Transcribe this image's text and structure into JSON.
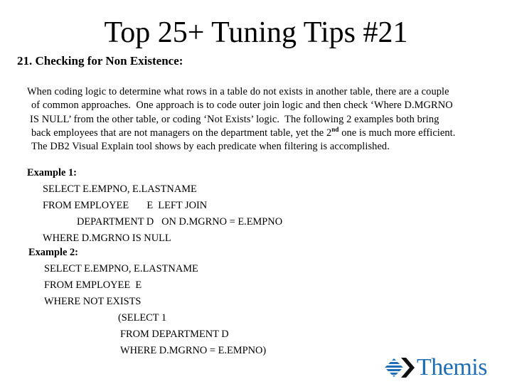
{
  "title": "Top 25+ Tuning Tips #21",
  "subheading": "21. Checking for Non Existence:",
  "paragraph": {
    "lines": [
      "When coding logic to determine what rows in a table do not exists in another table, there are a couple",
      "of common approaches.  One approach is to code outer join logic and then check ‘Where D.MGRNO",
      "IS NULL’ from the other table, or coding ‘Not Exists’ logic.  The following 2 examples both bring"
    ],
    "line4_before": "back employees that are not managers on the department table, yet the 2",
    "line4_sup": "nd",
    "line4_after": " one is much more efficient.",
    "line5": "The DB2 Visual Explain tool shows by each predicate when filtering is accomplished."
  },
  "example1": {
    "heading": "Example 1:",
    "lines": [
      "SELECT E.EMPNO, E.LASTNAME",
      "FROM EMPLOYEE       E  LEFT JOIN",
      "DEPARTMENT D   ON D.MGRNO = E.EMPNO",
      "WHERE D.MGRNO IS NULL"
    ]
  },
  "example2": {
    "heading": "Example 2:",
    "lines": [
      "SELECT E.EMPNO, E.LASTNAME",
      "FROM EMPLOYEE  E",
      "WHERE NOT EXISTS",
      "(SELECT 1",
      "FROM DEPARTMENT D",
      "WHERE D.MGRNO = E.EMPNO)"
    ]
  },
  "logo": {
    "icon": "themis-diamond-chevron-icon",
    "text": "Themis",
    "brand_color": "#1f6db5",
    "chevron_color": "#111111"
  }
}
